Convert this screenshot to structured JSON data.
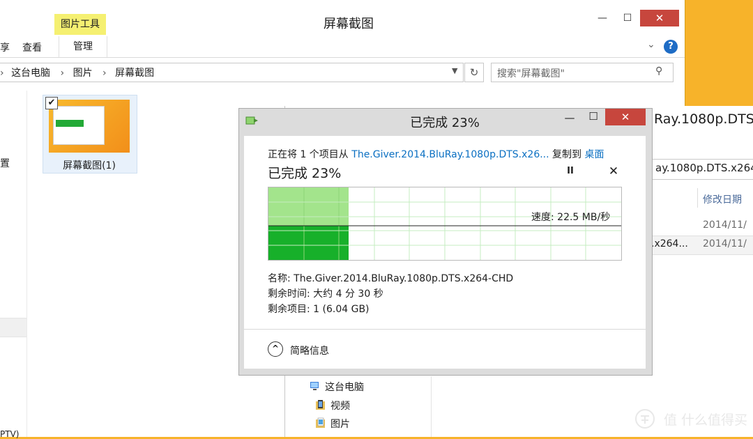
{
  "explorer": {
    "title": "屏幕截图",
    "ribbon_context": "图片工具",
    "tabs": {
      "share_fragment": "享",
      "view": "查看",
      "manage": "管理"
    },
    "window_controls": {
      "minimize": "—",
      "maximize": "☐",
      "close": "✕"
    },
    "help": "?",
    "address": {
      "crumbs": [
        "这台电脑",
        "图片",
        "屏幕截图"
      ],
      "separator": "›"
    },
    "search_placeholder": "搜索\"屏幕截图\"",
    "nav_fragments": [
      "置",
      "PTV)"
    ],
    "file": {
      "name": "屏幕截图(1)",
      "checked": true
    }
  },
  "background_window": {
    "title_fragment": "Ray.1080p.DTS.",
    "address_fragment": "ay.1080p.DTS.x264-",
    "column_header": "修改日期",
    "rows": [
      {
        "name_fragment": "",
        "date_fragment": "2014/11/"
      },
      {
        "name_fragment": ".x264...",
        "date_fragment": "2014/11/"
      }
    ],
    "tree": [
      {
        "label": "这台电脑",
        "icon": "computer-icon"
      },
      {
        "label": "视频",
        "icon": "videos-folder-icon"
      },
      {
        "label": "图片",
        "icon": "pictures-folder-icon"
      }
    ]
  },
  "dialog": {
    "title": "已完成 23%",
    "copy_prefix": "正在将 1 个项目从 ",
    "source": "The.Giver.2014.BluRay.1080p.DTS.x26...",
    "copy_middle": " 复制到 ",
    "destination": "桌面",
    "heading": "已完成 23%",
    "pause_symbol": "II",
    "cancel_symbol": "✕",
    "window_controls": {
      "minimize": "—",
      "maximize": "☐",
      "close": "✕"
    },
    "progress_percent": 23,
    "speed": "速度: 22.5 MB/秒",
    "name_line": "名称:  The.Giver.2014.BluRay.1080p.DTS.x264-CHD",
    "time_line": "剩余时间: 大约 4 分 30 秒",
    "items_line": "剩余项目: 1 (6.04 GB)",
    "details_toggle": "简略信息",
    "details_symbol": "^",
    "colors": {
      "progress_fill": "#a3e48c",
      "speed_fill": "#17b02a",
      "grid": "#c4ecc0"
    }
  },
  "watermark": {
    "text": "值 什么值得买",
    "logo": "smzdm-logo-icon"
  }
}
